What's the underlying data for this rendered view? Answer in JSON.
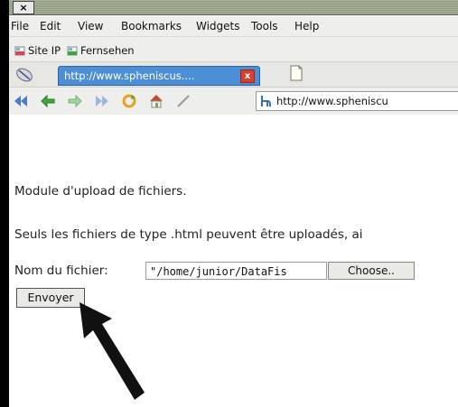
{
  "window": {
    "close_label": "×"
  },
  "menu": [
    "File",
    "Edit",
    "View",
    "Bookmarks",
    "Widgets",
    "Tools",
    "Help"
  ],
  "bookmarks": [
    "Site IP",
    "Fernsehen"
  ],
  "tab": {
    "label": "http://www.spheniscus....",
    "close_label": "x"
  },
  "url": {
    "value": "http://www.spheniscu"
  },
  "page": {
    "title_line": "Module d'upload de fichiers.",
    "info_line": "Seuls les fichiers de type .html peuvent être uploadés, ai",
    "file_label": "Nom du fichier:",
    "file_value": "\"/home/junior/DataFis",
    "choose_label": "Choose..",
    "submit_label": "Envoyer"
  }
}
